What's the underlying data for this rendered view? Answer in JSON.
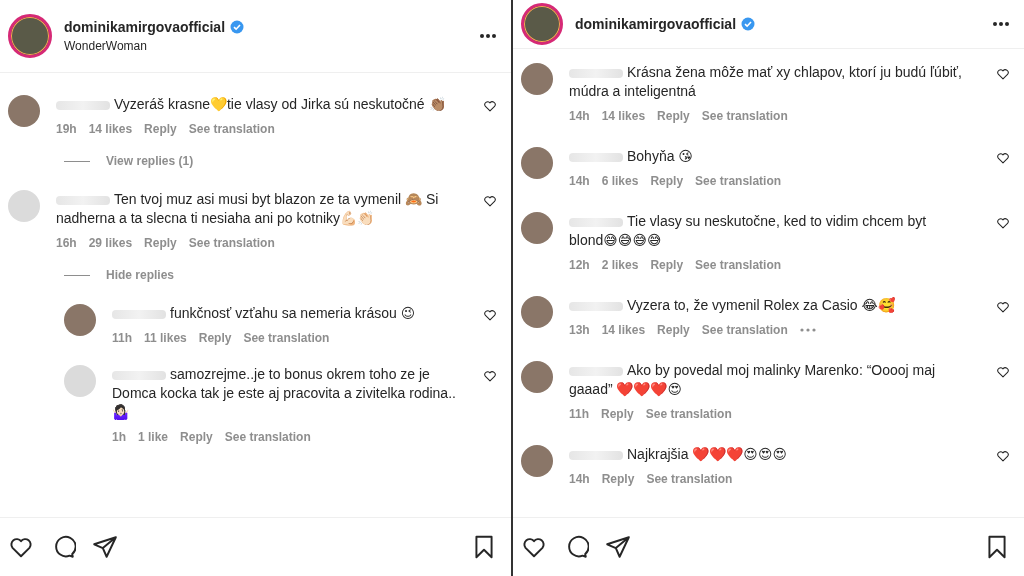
{
  "panels": [
    {
      "header": {
        "username": "dominikamirgovaofficial",
        "verified": true,
        "subtitle": "WonderWoman"
      },
      "comments": [
        {
          "text": "Vyzeráš krasne💛tie vlasy od Jirka sú neskutočné 👏🏽",
          "time": "19h",
          "likes": "14 likes",
          "reply": "Reply",
          "translation": "See translation",
          "replies_toggle": "View replies (1)"
        },
        {
          "text": "Ten tvoj muz asi musi byt blazon ze ta vymenil 🙈 Si nadherna a ta slecna ti nesiaha ani po kotniky💪🏻👏🏻",
          "time": "16h",
          "likes": "29 likes",
          "reply": "Reply",
          "translation": "See translation",
          "replies_toggle": "Hide replies",
          "replies": [
            {
              "text": "funkčnosť vzťahu sa nemeria krásou 😉",
              "time": "11h",
              "likes": "11 likes",
              "reply": "Reply",
              "translation": "See translation"
            },
            {
              "text": "samozrejme..je to bonus okrem toho ze je Domca kocka tak je este aj pracovita a zivitelka rodina..🤷🏻‍♀️",
              "time": "1h",
              "likes": "1 like",
              "reply": "Reply",
              "translation": "See translation"
            }
          ]
        }
      ]
    },
    {
      "header": {
        "username": "dominikamirgovaofficial",
        "verified": true
      },
      "comments": [
        {
          "text": "Krásna žena môže mať xy chlapov, ktorí ju budú ľúbiť, múdra a inteligentná",
          "time": "14h",
          "likes": "14 likes",
          "reply": "Reply",
          "translation": "See translation"
        },
        {
          "text": "Bohyňa 😘",
          "time": "14h",
          "likes": "6 likes",
          "reply": "Reply",
          "translation": "See translation"
        },
        {
          "text": "Tie vlasy su neskutočne, ked to vidim chcem byt blond😅😅😅😅",
          "time": "12h",
          "likes": "2 likes",
          "reply": "Reply",
          "translation": "See translation"
        },
        {
          "text": "Vyzera to, že vymenil Rolex za Casio 😂🥰",
          "time": "13h",
          "likes": "14 likes",
          "reply": "Reply",
          "translation": "See translation",
          "more": true
        },
        {
          "text": "Ako by povedal moj malinky Marenko: “Ooooj maj gaaad” ❤️❤️❤️😍",
          "time": "11h",
          "reply": "Reply",
          "translation": "See translation"
        },
        {
          "text": "Najkrajšia ❤️❤️❤️😍😍😍",
          "time": "14h",
          "reply": "Reply",
          "translation": "See translation"
        }
      ]
    }
  ]
}
